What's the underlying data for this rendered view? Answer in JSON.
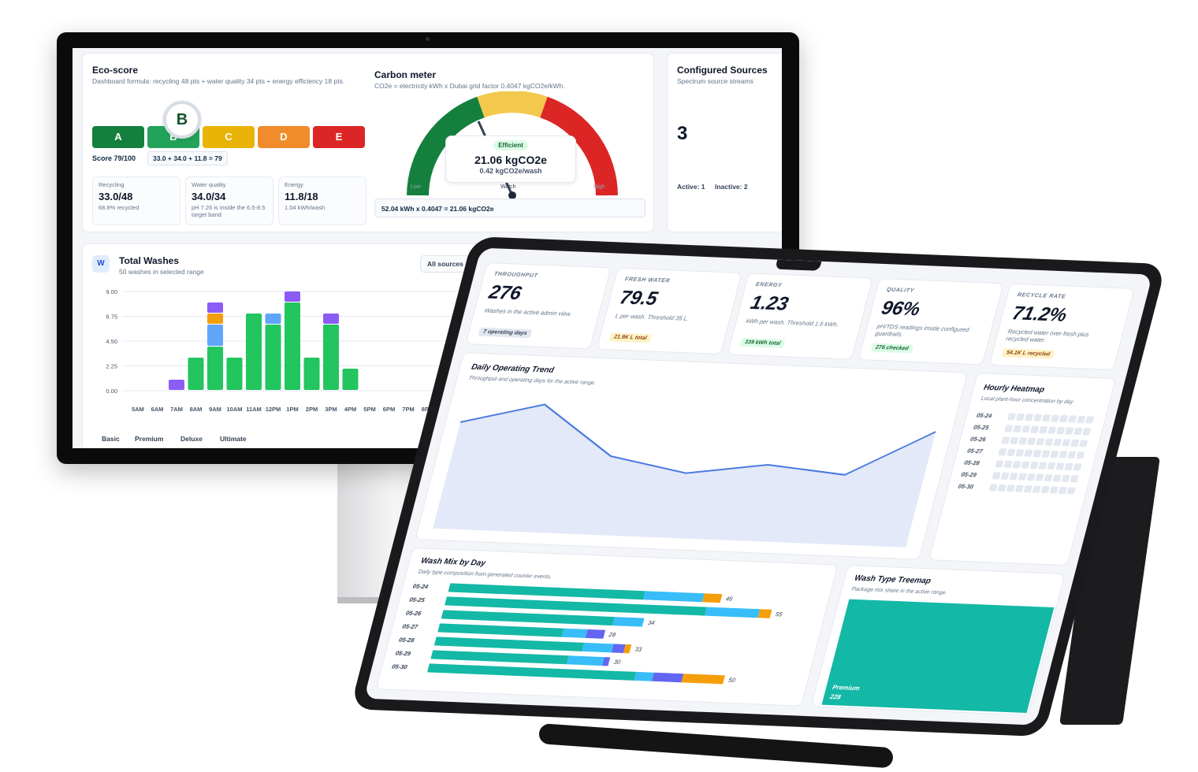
{
  "monitor": {
    "eco": {
      "title": "Eco-score",
      "formula": "Dashboard formula: recycling 48 pts + water quality 34 pts + energy efficiency 18 pts.",
      "grades": [
        "A",
        "B",
        "C",
        "D",
        "E"
      ],
      "grade_colors": [
        "#15803d",
        "#22a35a",
        "#eab308",
        "#f08c2c",
        "#dc2626"
      ],
      "selected_grade": "B",
      "score": "Score 79/100",
      "calc": "33.0 + 34.0 + 11.8 = 79",
      "tiles": [
        {
          "label": "Recycling",
          "value": "33.0/48",
          "note": "68.8% recycled"
        },
        {
          "label": "Water quality",
          "value": "34.0/34",
          "note": "pH 7.26 is inside the 6.5-8.5 target band"
        },
        {
          "label": "Energy",
          "value": "11.8/18",
          "note": "1.04 kWh/wash"
        }
      ]
    },
    "carbon": {
      "title": "Carbon meter",
      "subtitle": "CO2e = electricity kWh x Dubai grid factor 0.4047 kgCO2e/kWh.",
      "badge": "Efficient",
      "value": "21.06 kgCO2e",
      "per_wash": "0.42 kgCO2e/wash",
      "low": "Low",
      "watch": "Watch",
      "high": "High",
      "formula": "52.04 kWh x 0.4047 = 21.06 kgCO2e"
    },
    "sources": {
      "title": "Configured Sources",
      "subtitle": "Spectrum source streams",
      "count": "3",
      "active": "Active: 1",
      "inactive": "Inactive: 2"
    },
    "washes": {
      "icon_letter": "W",
      "title": "Total Washes",
      "subtitle": "50 washes in selected range",
      "filter": "All sources",
      "legend": [
        "Basic",
        "Premium",
        "Deluxe",
        "Ultimate"
      ],
      "colors": {
        "basic": "#22c55e",
        "premium": "#60a5fa",
        "deluxe": "#f59e0b",
        "ultimate": "#8b5cf6"
      }
    }
  },
  "chart_data": [
    {
      "type": "bar",
      "title": "Total Washes",
      "categories": [
        "5AM",
        "6AM",
        "7AM",
        "8AM",
        "9AM",
        "10AM",
        "11AM",
        "12PM",
        "1PM",
        "2PM",
        "3PM",
        "4PM",
        "5PM",
        "6PM",
        "7PM",
        "8PM"
      ],
      "series": [
        {
          "name": "Basic",
          "values": [
            0,
            0,
            0,
            3,
            4,
            3,
            7,
            6,
            8,
            3,
            6,
            2,
            0,
            0,
            0,
            0
          ]
        },
        {
          "name": "Premium",
          "values": [
            0,
            0,
            0,
            0,
            2,
            0,
            0,
            1,
            0,
            0,
            0,
            0,
            0,
            0,
            0,
            0
          ]
        },
        {
          "name": "Deluxe",
          "values": [
            0,
            0,
            0,
            0,
            1,
            0,
            0,
            0,
            0,
            0,
            0,
            0,
            0,
            0,
            0,
            0
          ]
        },
        {
          "name": "Ultimate",
          "values": [
            0,
            0,
            1,
            0,
            1,
            0,
            0,
            0,
            1,
            0,
            1,
            0,
            0,
            0,
            0,
            0
          ]
        }
      ],
      "y_ticks": [
        "9.00",
        "6.75",
        "4.50",
        "2.25",
        "0.00"
      ],
      "ylim": [
        0,
        9
      ]
    },
    {
      "type": "area",
      "title": "Daily Operating Trend",
      "categories": [
        "05-24",
        "05-25",
        "05-26",
        "05-27",
        "05-28",
        "05-29",
        "05-30"
      ],
      "values": [
        46,
        55,
        34,
        28,
        33,
        30,
        50
      ],
      "ylim": [
        0,
        60
      ]
    },
    {
      "type": "bar",
      "title": "Wash Mix by Day",
      "categories": [
        "05-24",
        "05-25",
        "05-26",
        "05-27",
        "05-28",
        "05-29",
        "05-30"
      ],
      "series": [
        {
          "name": "Basic",
          "values": [
            33,
            44,
            29,
            21,
            25,
            23,
            35
          ]
        },
        {
          "name": "Premium",
          "values": [
            10,
            9,
            5,
            4,
            5,
            6,
            3
          ]
        },
        {
          "name": "Deluxe",
          "values": [
            0,
            0,
            0,
            3,
            2,
            1,
            5
          ]
        },
        {
          "name": "Ultimate",
          "values": [
            3,
            2,
            0,
            0,
            1,
            0,
            7
          ]
        }
      ],
      "totals": [
        "46",
        "55",
        "34",
        "28",
        "33",
        "30",
        "50"
      ]
    }
  ],
  "tablet": {
    "kpis": [
      {
        "label": "THROUGHPUT",
        "value": "276",
        "note": "Washes in the active admin view.",
        "badge": "7 operating days",
        "badge_color": "#e2e8f0",
        "badge_text": "#334155"
      },
      {
        "label": "FRESH WATER",
        "value": "79.5",
        "note": "L per wash. Threshold 35 L.",
        "badge": "21.9K L total",
        "badge_color": "#fef3c7",
        "badge_text": "#92400e"
      },
      {
        "label": "ENERGY",
        "value": "1.23",
        "note": "kWh per wash. Threshold 1.6 kWh.",
        "badge": "339 kWh total",
        "badge_color": "#dcfce7",
        "badge_text": "#166534"
      },
      {
        "label": "QUALITY",
        "value": "96%",
        "note": "pH/TDS readings inside configured guardrails.",
        "badge": "276 checked",
        "badge_color": "#dcfce7",
        "badge_text": "#166534"
      },
      {
        "label": "RECYCLE RATE",
        "value": "71.2%",
        "note": "Recycled water over fresh plus recycled water.",
        "badge": "54.1K L recycled",
        "badge_color": "#fef3c7",
        "badge_text": "#92400e"
      }
    ],
    "trend": {
      "title": "Daily Operating Trend",
      "subtitle": "Throughput and operating days for the active range."
    },
    "heatmap": {
      "title": "Hourly Heatmap",
      "subtitle": "Local plant-hour concentration by day",
      "days": [
        "05-24",
        "05-25",
        "05-26",
        "05-27",
        "05-28",
        "05-29",
        "05-30"
      ]
    },
    "mix": {
      "title": "Wash Mix by Day",
      "subtitle": "Daily type composition from generated counter events."
    },
    "treemap": {
      "title": "Wash Type Treemap",
      "subtitle": "Package mix share in the active range.",
      "block_label": "Premium",
      "block_value": "228",
      "color": "#14b8a6"
    }
  }
}
